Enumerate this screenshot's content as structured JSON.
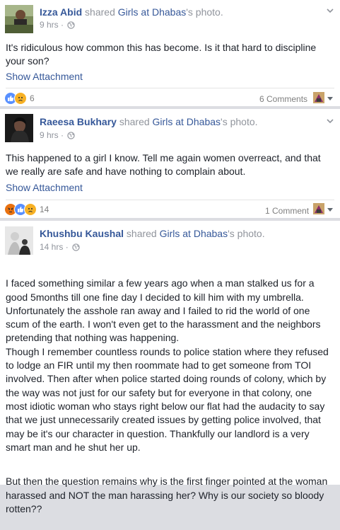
{
  "posts": [
    {
      "author": "Izza Abid",
      "verb": "shared",
      "page": "Girls at Dhabas",
      "suffix": "'s photo.",
      "time": "9 hrs",
      "separator": "·",
      "text": [
        "It's ridiculous how common this has become. Is it that hard to discipline your son?"
      ],
      "attachment_label": "Show Attachment",
      "reactions": [
        "like",
        "sad"
      ],
      "reaction_count": "6",
      "comments": "6 Comments"
    },
    {
      "author": "Raeesa Bukhary",
      "verb": "shared",
      "page": "Girls at Dhabas",
      "suffix": "'s photo.",
      "time": "9 hrs",
      "separator": "·",
      "text": [
        "This happened to a girl I know. Tell me again women overreact, and that we really are safe and have nothing to complain about."
      ],
      "attachment_label": "Show Attachment",
      "reactions": [
        "angry",
        "like",
        "sad"
      ],
      "reaction_count": "14",
      "comments": "1 Comment"
    },
    {
      "author": "Khushbu Kaushal",
      "verb": "shared",
      "page": "Girls at Dhabas",
      "suffix": "'s photo.",
      "time": "14 hrs",
      "separator": "·",
      "text": [
        "I faced something similar a few years ago when a man stalked us for a good 5months till one fine day I decided to kill him with my umbrella. Unfortunately the asshole ran away and I failed to rid the world of one scum of the earth. I won't even get to the harassment and the neighbors pretending that nothing was happening.\nThough I remember countless rounds to police station where they refused to lodge an FIR until my then roommate had to get someone from TOI involved. Then after when police started doing rounds of colony, which by the way was not just for our safety but for everyone in that colony, one most idiotic woman who stays right below our flat had the audacity to say that we just unnecessarily created issues by getting police involved, that may be it's our character in question. Thankfully our landlord is a very smart man and he shut her up.",
        "But then the question remains why is the first finger pointed at the woman harassed and NOT the man harassing her? Why is our society so bloody rotten??"
      ]
    }
  ],
  "colors": {
    "link": "#365899",
    "meta": "#90949c",
    "text": "#1d2129",
    "like": "#5890ff",
    "sad": "#f7b125",
    "angry": "#e9710f"
  }
}
